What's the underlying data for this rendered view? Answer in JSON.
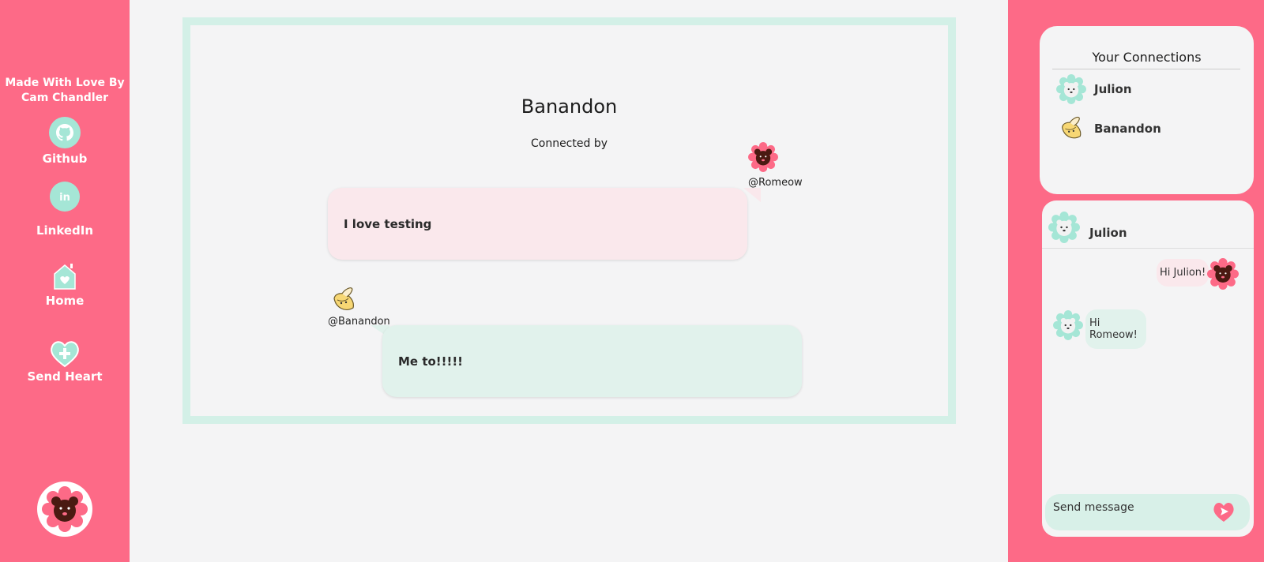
{
  "left_sidebar": {
    "credit": "Made With Love By Cam Chandler",
    "nav": [
      {
        "label": "Github",
        "icon": "github-icon"
      },
      {
        "label": "LinkedIn",
        "icon": "linkedin-icon"
      },
      {
        "label": "Home",
        "icon": "home-icon"
      },
      {
        "label": "Send Heart",
        "icon": "send-heart-icon"
      }
    ],
    "user_avatar": "bear-avatar"
  },
  "connection": {
    "title": "Banandon",
    "subtitle": "Connected by",
    "messages": [
      {
        "handle": "@Romeow",
        "avatar": "bear-avatar",
        "text": "I love testing"
      },
      {
        "handle": "@Banandon",
        "avatar": "banana-avatar",
        "text": "Me to!!!!!"
      }
    ]
  },
  "connections_panel": {
    "title": "Your Connections",
    "items": [
      {
        "name": "Julion",
        "avatar": "lion-avatar"
      },
      {
        "name": "Banandon",
        "avatar": "banana-avatar"
      }
    ]
  },
  "chat": {
    "name": "Julion",
    "messages": [
      {
        "text": "Hi Julion!",
        "direction": "out"
      },
      {
        "text": "Hi Romeow!",
        "direction": "in"
      }
    ],
    "input_placeholder": "Send message"
  },
  "colors": {
    "brand_pink": "#fd6a87",
    "mint": "#a5e6d6",
    "bubble_pink": "#fae8ec",
    "bubble_mint": "#e1f2ec"
  }
}
